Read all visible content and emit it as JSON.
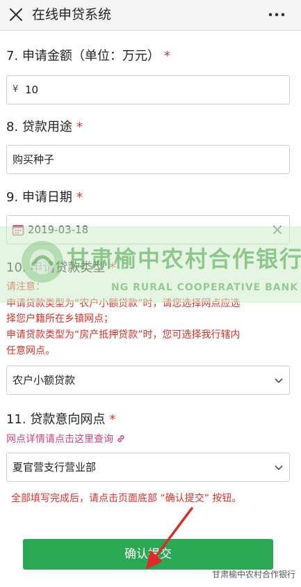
{
  "header": {
    "title": "在线申贷系统"
  },
  "questions": {
    "q7": {
      "label": "7. 申请金额（单位：万元）",
      "required": "*",
      "prefix": "¥",
      "value": "10"
    },
    "q8": {
      "label": "8. 贷款用途",
      "required": "*",
      "value": "购买种子"
    },
    "q9": {
      "label": "9. 申请日期",
      "required": "*",
      "value": "2019-03-18"
    },
    "q10": {
      "label": "10. 申请贷款类型",
      "required": "*",
      "notes": [
        "请注意：",
        "申请贷款类型为“农户小额贷款”时，请您选择网点应选",
        "择您户籍所在乡镇网点；",
        "申请贷款类型为“房产抵押贷款”时，您可选择我行辖内",
        "任意网点。"
      ],
      "value": "农户小额贷款"
    },
    "q11": {
      "label": "11. 贷款意向网点",
      "required": "*",
      "link": "网点详情请点击这里查询",
      "value": "夏官营支行营业部"
    }
  },
  "hint": "全部填写完成后，请点击页面底部 “确认提交” 按钮。",
  "submit_label": "确认提交",
  "watermark": {
    "cn": "甘肃榆中农村合作银行",
    "en": "NG RURAL COOPERATIVE BANK"
  },
  "footer_brand": "甘肃榆中农村合作银行",
  "colors": {
    "accent": "#2aa853",
    "required": "#d9342b",
    "link": "#c84a7b"
  },
  "icons": [
    "close-icon",
    "more-icon",
    "calendar-icon",
    "clear-icon",
    "chevron-down-icon",
    "link-icon",
    "wechat-icon"
  ]
}
